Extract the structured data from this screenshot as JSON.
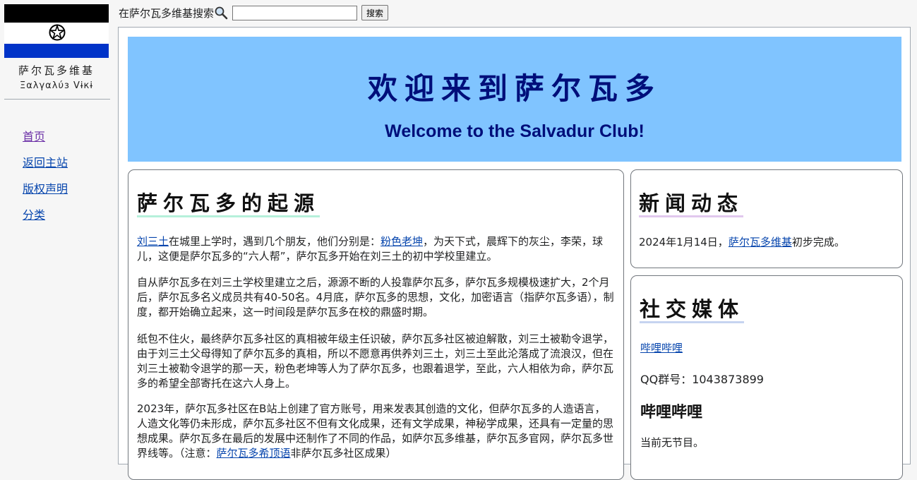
{
  "sidebar": {
    "site_name": "萨尔瓦多维基",
    "site_name_alt": "Ξαλγαλύз Vɨкɨ",
    "nav": [
      {
        "label": "首页"
      },
      {
        "label": "返回主站"
      },
      {
        "label": "版权声明"
      },
      {
        "label": "分类"
      }
    ]
  },
  "search": {
    "label": "在萨尔瓦多维基搜索",
    "value": "",
    "button_label": "搜索"
  },
  "banner": {
    "title": "欢迎来到萨尔瓦多",
    "subtitle": "Welcome to the Salvadur Club!"
  },
  "origin": {
    "heading": "萨尔瓦多的起源",
    "p1": {
      "link1": "刘三土",
      "text1": "在城里上学时，遇到几个朋友，他们分别是：",
      "link2": "粉色老坤",
      "text2": "，为天下式，晨辉下的灰尘，李荣，球儿，这便是萨尔瓦多的“六人帮”，萨尔瓦多开始在刘三土的初中学校里建立。"
    },
    "p2": "自从萨尔瓦多在刘三土学校里建立之后，源源不断的人投靠萨尔瓦多，萨尔瓦多规模极速扩大，2个月后，萨尔瓦多名义成员共有40-50名。4月底，萨尔瓦多的思想，文化，加密语言（指萨尔瓦多语），制度，都开始确立起来，这一时间段是萨尔瓦多在校的鼎盛时期。",
    "p3": "纸包不住火，最终萨尔瓦多社区的真相被年级主任识破，萨尔瓦多社区被迫解散，刘三土被勒令退学，由于刘三土父母得知了萨尔瓦多的真相，所以不愿意再供养刘三土，刘三土至此沦落成了流浪汉，但在刘三土被勒令退学的那一天，粉色老坤等人为了萨尔瓦多，也跟着退学，至此，六人相依为命，萨尔瓦多的希望全部寄托在这六人身上。",
    "p4": {
      "text1": "2023年，萨尔瓦多社区在B站上创建了官方账号，用来发表其创造的文化，但萨尔瓦多的人造语言，人造文化等仍未形成，萨尔瓦多社区不但有文化成果，还有文学成果，神秘学成果，还具有一定量的思想成果。萨尔瓦多在最后的发展中还制作了不同的作品，如萨尔瓦多维基，萨尔瓦多官网，萨尔瓦多世界线等。（注意：",
      "link": "萨尔瓦多希顶语",
      "text2": "非萨尔瓦多社区成果）"
    }
  },
  "news": {
    "heading": "新闻动态",
    "date_text": "2024年1月14日，",
    "link": "萨尔瓦多维基",
    "suffix": "初步完成。"
  },
  "social": {
    "heading": "社交媒体",
    "bilibili_link": "哔哩哔哩",
    "qq": "QQ群号：1043873899",
    "sub_heading": "哔哩哔哩",
    "no_show": "当前无节目。"
  },
  "colors": {
    "banner_bg": "#80c4ff",
    "banner_text": "#000e7a",
    "link": "#0645ad",
    "visited_link": "#6b2fa6",
    "flag_black": "#000000",
    "flag_white": "#ffffff",
    "flag_blue": "#0033c8"
  },
  "icons": {
    "flag_emblem": "pentagram-circle-icon",
    "search": "magnifier-icon"
  }
}
